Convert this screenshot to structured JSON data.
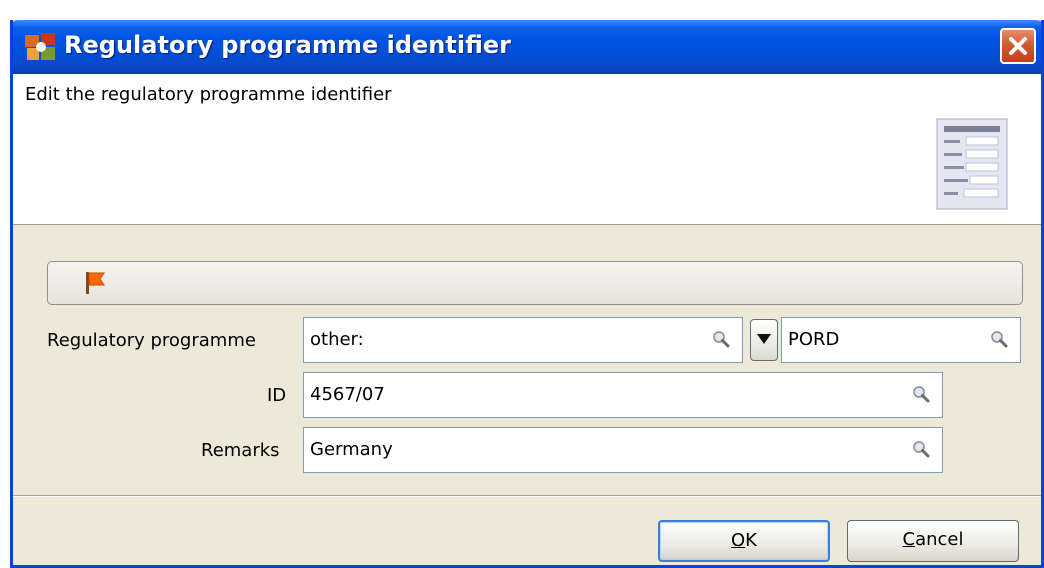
{
  "dialog": {
    "title": "Regulatory programme identifier",
    "description": "Edit the regulatory programme identifier"
  },
  "form": {
    "regulatory_programme": {
      "label": "Regulatory programme",
      "value": "other:",
      "secondary_value": "PORD"
    },
    "id": {
      "label": "ID",
      "value": "4567/07"
    },
    "remarks": {
      "label": "Remarks",
      "value": "Germany"
    }
  },
  "buttons": {
    "ok_mnemonic": "O",
    "ok_rest": "K",
    "cancel_mnemonic": "C",
    "cancel_rest": "ancel"
  },
  "colors": {
    "titlebar": "#0054e3",
    "dialog_bg": "#ece9d8",
    "close_button": "#d45a30",
    "flag": "#ff6a00"
  },
  "icons": {
    "app": "app-logo-icon",
    "close": "close-icon",
    "document": "form-document-icon",
    "flag": "flag-icon",
    "search": "magnifier-icon",
    "dropdown": "triangle-down-icon"
  }
}
